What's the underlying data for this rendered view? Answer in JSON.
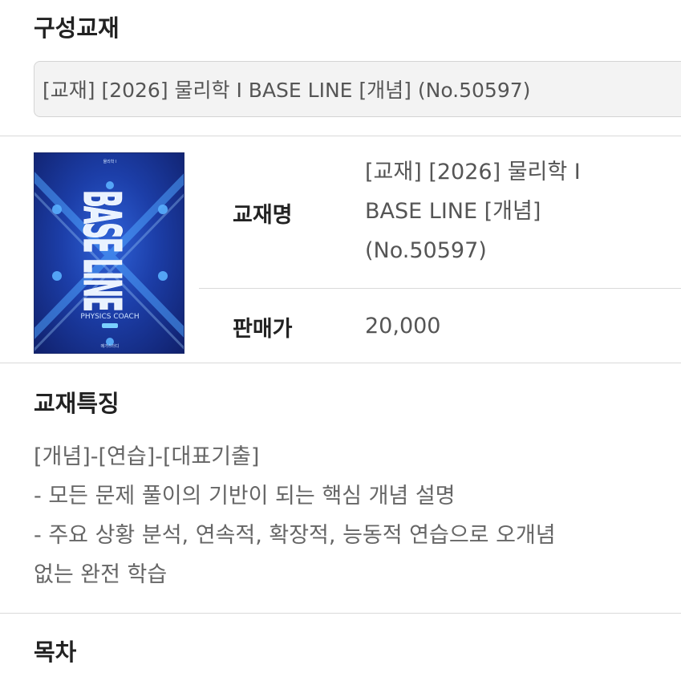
{
  "sections": {
    "composition_title": "구성교재",
    "features_title": "교재특징",
    "toc_title": "목차"
  },
  "select": {
    "value": "[교재] [2026] 물리학 Ⅰ BASE LINE [개념] (No.50597)"
  },
  "book": {
    "cover_title": "BASE LINE",
    "cover_subtitle": "PHYSICS COACH",
    "name_label": "교재명",
    "name_line1": "[교재] [2026] 물리학 Ⅰ",
    "name_line2": "BASE LINE [개념]",
    "name_line3": "(No.50597)",
    "price_label": "판매가",
    "price_value": "20,000"
  },
  "features": {
    "lines": [
      "[개념]-[연습]-[대표기출]",
      "- 모든 문제 풀이의 기반이 되는 핵심 개념 설명",
      "- 주요 상황 분석, 연속적, 확장적, 능동적 연습으로 오개념",
      "없는 완전 학습"
    ]
  },
  "colors": {
    "cover_blue": "#1c3ea8",
    "divider": "#d9d9d9",
    "select_bg": "#f3f3f3"
  }
}
